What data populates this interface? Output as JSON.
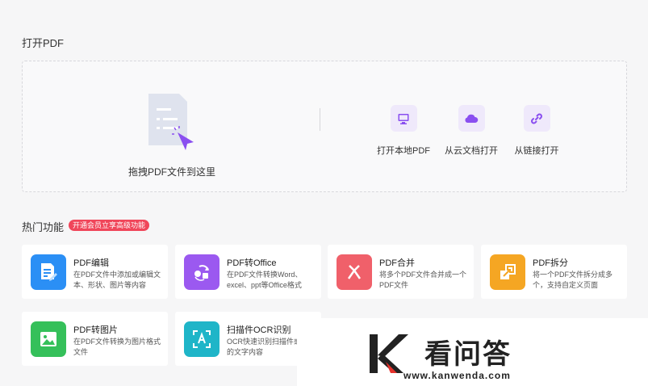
{
  "open_pdf": {
    "title": "打开PDF",
    "drop_label": "拖拽PDF文件到这里",
    "options": [
      {
        "label": "打开本地PDF",
        "icon": "monitor-icon"
      },
      {
        "label": "从云文档打开",
        "icon": "cloud-icon"
      },
      {
        "label": "从链接打开",
        "icon": "link-icon"
      }
    ]
  },
  "hot": {
    "title": "热门功能",
    "badge": "开通会员立享高级功能",
    "cards": [
      {
        "title": "PDF编辑",
        "desc": "在PDF文件中添加或编辑文本、形状、图片等内容",
        "color": "#2b8ff5",
        "icon": "edit-document-icon"
      },
      {
        "title": "PDF转Office",
        "desc": "在PDF文件转换Word、excel、ppt等Office格式",
        "color": "#9b59f0",
        "icon": "convert-icon"
      },
      {
        "title": "PDF合并",
        "desc": "将多个PDF文件合并成一个PDF文件",
        "color": "#f0606a",
        "icon": "merge-icon"
      },
      {
        "title": "PDF拆分",
        "desc": "将一个PDF文件拆分成多个，支持自定义页面",
        "color": "#f5a623",
        "icon": "split-icon"
      },
      {
        "title": "PDF转图片",
        "desc": "在PDF文件转换为图片格式文件",
        "color": "#35c05a",
        "icon": "image-icon"
      },
      {
        "title": "扫描件OCR识别",
        "desc": "OCR快速识别扫描件或片中的文字内容",
        "color": "#1fb5c8",
        "icon": "ocr-icon"
      }
    ]
  },
  "watermark": {
    "text": "看问答",
    "url": "www.kanwenda.com"
  }
}
